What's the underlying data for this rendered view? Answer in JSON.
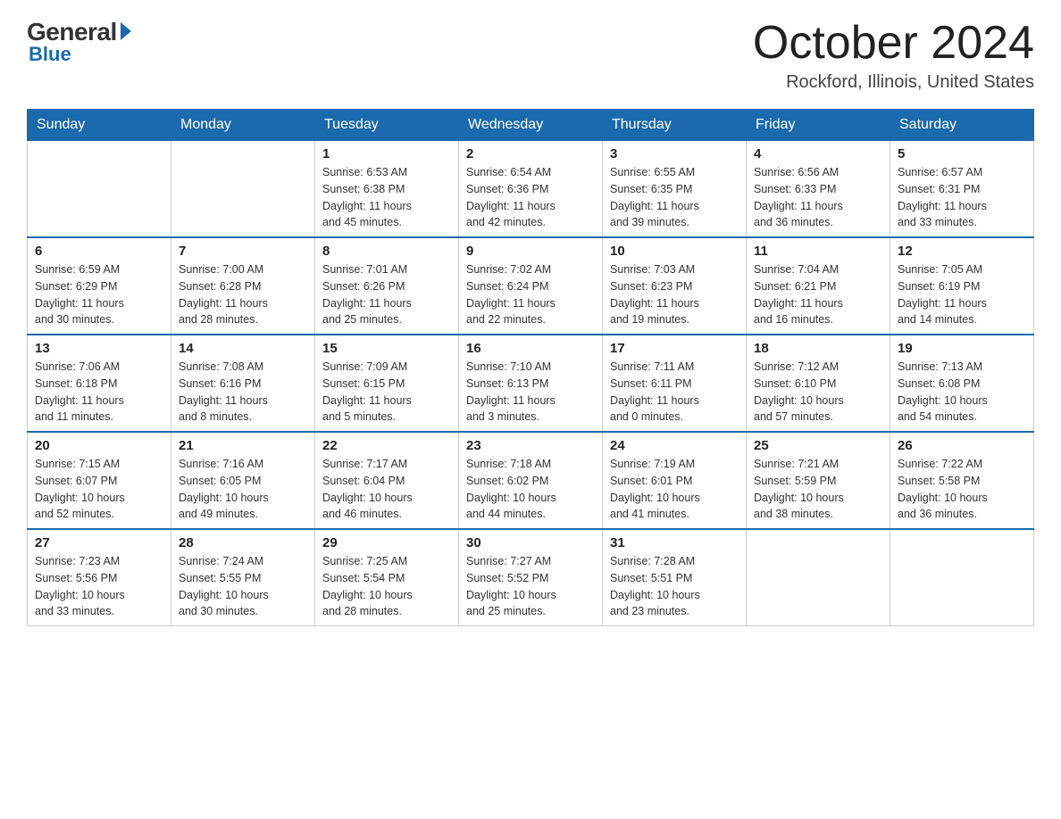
{
  "header": {
    "logo": {
      "general": "General",
      "blue": "Blue"
    },
    "title": "October 2024",
    "location": "Rockford, Illinois, United States"
  },
  "calendar": {
    "days_of_week": [
      "Sunday",
      "Monday",
      "Tuesday",
      "Wednesday",
      "Thursday",
      "Friday",
      "Saturday"
    ],
    "weeks": [
      [
        {
          "day": "",
          "info": ""
        },
        {
          "day": "",
          "info": ""
        },
        {
          "day": "1",
          "info": "Sunrise: 6:53 AM\nSunset: 6:38 PM\nDaylight: 11 hours\nand 45 minutes."
        },
        {
          "day": "2",
          "info": "Sunrise: 6:54 AM\nSunset: 6:36 PM\nDaylight: 11 hours\nand 42 minutes."
        },
        {
          "day": "3",
          "info": "Sunrise: 6:55 AM\nSunset: 6:35 PM\nDaylight: 11 hours\nand 39 minutes."
        },
        {
          "day": "4",
          "info": "Sunrise: 6:56 AM\nSunset: 6:33 PM\nDaylight: 11 hours\nand 36 minutes."
        },
        {
          "day": "5",
          "info": "Sunrise: 6:57 AM\nSunset: 6:31 PM\nDaylight: 11 hours\nand 33 minutes."
        }
      ],
      [
        {
          "day": "6",
          "info": "Sunrise: 6:59 AM\nSunset: 6:29 PM\nDaylight: 11 hours\nand 30 minutes."
        },
        {
          "day": "7",
          "info": "Sunrise: 7:00 AM\nSunset: 6:28 PM\nDaylight: 11 hours\nand 28 minutes."
        },
        {
          "day": "8",
          "info": "Sunrise: 7:01 AM\nSunset: 6:26 PM\nDaylight: 11 hours\nand 25 minutes."
        },
        {
          "day": "9",
          "info": "Sunrise: 7:02 AM\nSunset: 6:24 PM\nDaylight: 11 hours\nand 22 minutes."
        },
        {
          "day": "10",
          "info": "Sunrise: 7:03 AM\nSunset: 6:23 PM\nDaylight: 11 hours\nand 19 minutes."
        },
        {
          "day": "11",
          "info": "Sunrise: 7:04 AM\nSunset: 6:21 PM\nDaylight: 11 hours\nand 16 minutes."
        },
        {
          "day": "12",
          "info": "Sunrise: 7:05 AM\nSunset: 6:19 PM\nDaylight: 11 hours\nand 14 minutes."
        }
      ],
      [
        {
          "day": "13",
          "info": "Sunrise: 7:06 AM\nSunset: 6:18 PM\nDaylight: 11 hours\nand 11 minutes."
        },
        {
          "day": "14",
          "info": "Sunrise: 7:08 AM\nSunset: 6:16 PM\nDaylight: 11 hours\nand 8 minutes."
        },
        {
          "day": "15",
          "info": "Sunrise: 7:09 AM\nSunset: 6:15 PM\nDaylight: 11 hours\nand 5 minutes."
        },
        {
          "day": "16",
          "info": "Sunrise: 7:10 AM\nSunset: 6:13 PM\nDaylight: 11 hours\nand 3 minutes."
        },
        {
          "day": "17",
          "info": "Sunrise: 7:11 AM\nSunset: 6:11 PM\nDaylight: 11 hours\nand 0 minutes."
        },
        {
          "day": "18",
          "info": "Sunrise: 7:12 AM\nSunset: 6:10 PM\nDaylight: 10 hours\nand 57 minutes."
        },
        {
          "day": "19",
          "info": "Sunrise: 7:13 AM\nSunset: 6:08 PM\nDaylight: 10 hours\nand 54 minutes."
        }
      ],
      [
        {
          "day": "20",
          "info": "Sunrise: 7:15 AM\nSunset: 6:07 PM\nDaylight: 10 hours\nand 52 minutes."
        },
        {
          "day": "21",
          "info": "Sunrise: 7:16 AM\nSunset: 6:05 PM\nDaylight: 10 hours\nand 49 minutes."
        },
        {
          "day": "22",
          "info": "Sunrise: 7:17 AM\nSunset: 6:04 PM\nDaylight: 10 hours\nand 46 minutes."
        },
        {
          "day": "23",
          "info": "Sunrise: 7:18 AM\nSunset: 6:02 PM\nDaylight: 10 hours\nand 44 minutes."
        },
        {
          "day": "24",
          "info": "Sunrise: 7:19 AM\nSunset: 6:01 PM\nDaylight: 10 hours\nand 41 minutes."
        },
        {
          "day": "25",
          "info": "Sunrise: 7:21 AM\nSunset: 5:59 PM\nDaylight: 10 hours\nand 38 minutes."
        },
        {
          "day": "26",
          "info": "Sunrise: 7:22 AM\nSunset: 5:58 PM\nDaylight: 10 hours\nand 36 minutes."
        }
      ],
      [
        {
          "day": "27",
          "info": "Sunrise: 7:23 AM\nSunset: 5:56 PM\nDaylight: 10 hours\nand 33 minutes."
        },
        {
          "day": "28",
          "info": "Sunrise: 7:24 AM\nSunset: 5:55 PM\nDaylight: 10 hours\nand 30 minutes."
        },
        {
          "day": "29",
          "info": "Sunrise: 7:25 AM\nSunset: 5:54 PM\nDaylight: 10 hours\nand 28 minutes."
        },
        {
          "day": "30",
          "info": "Sunrise: 7:27 AM\nSunset: 5:52 PM\nDaylight: 10 hours\nand 25 minutes."
        },
        {
          "day": "31",
          "info": "Sunrise: 7:28 AM\nSunset: 5:51 PM\nDaylight: 10 hours\nand 23 minutes."
        },
        {
          "day": "",
          "info": ""
        },
        {
          "day": "",
          "info": ""
        }
      ]
    ]
  }
}
